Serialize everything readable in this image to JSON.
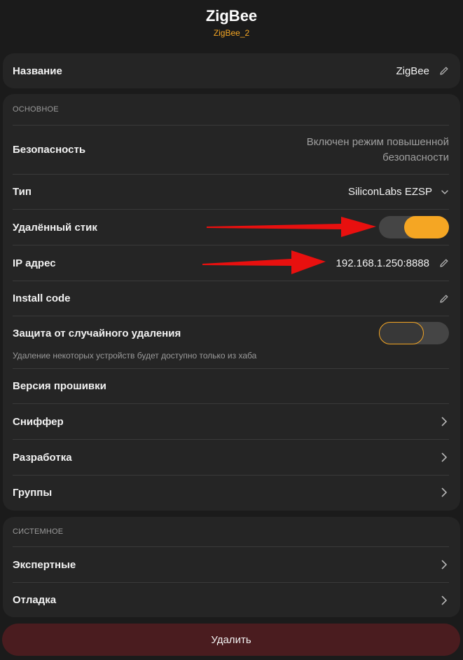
{
  "header": {
    "title": "ZigBee",
    "subtitle": "ZigBee_2"
  },
  "name_row": {
    "label": "Название",
    "value": "ZigBee"
  },
  "main": {
    "section_title": "ОСНОВНОЕ",
    "security": {
      "label": "Безопасность",
      "value_line1": "Включен режим повышенной",
      "value_line2": "безопасности"
    },
    "type": {
      "label": "Тип",
      "value": "SiliconLabs EZSP"
    },
    "remote_stick": {
      "label": "Удалённый стик",
      "enabled": true
    },
    "ip": {
      "label": "IP адрес",
      "value": "192.168.1.250:8888"
    },
    "install_code": {
      "label": "Install code"
    },
    "delete_protect": {
      "label": "Защита от случайного удаления",
      "enabled": false,
      "hint": "Удаление некоторых устройств будет доступно только из хаба"
    },
    "firmware": {
      "label": "Версия прошивки"
    },
    "sniffer": {
      "label": "Сниффер"
    },
    "development": {
      "label": "Разработка"
    },
    "groups": {
      "label": "Группы"
    }
  },
  "system": {
    "section_title": "СИСТЕМНОЕ",
    "expert": {
      "label": "Экспертные"
    },
    "debug": {
      "label": "Отладка"
    }
  },
  "delete_button": {
    "label": "Удалить"
  },
  "colors": {
    "accent": "#f5a623",
    "annotation_arrow": "#e8100f",
    "danger_bg": "#4a1c1f"
  }
}
